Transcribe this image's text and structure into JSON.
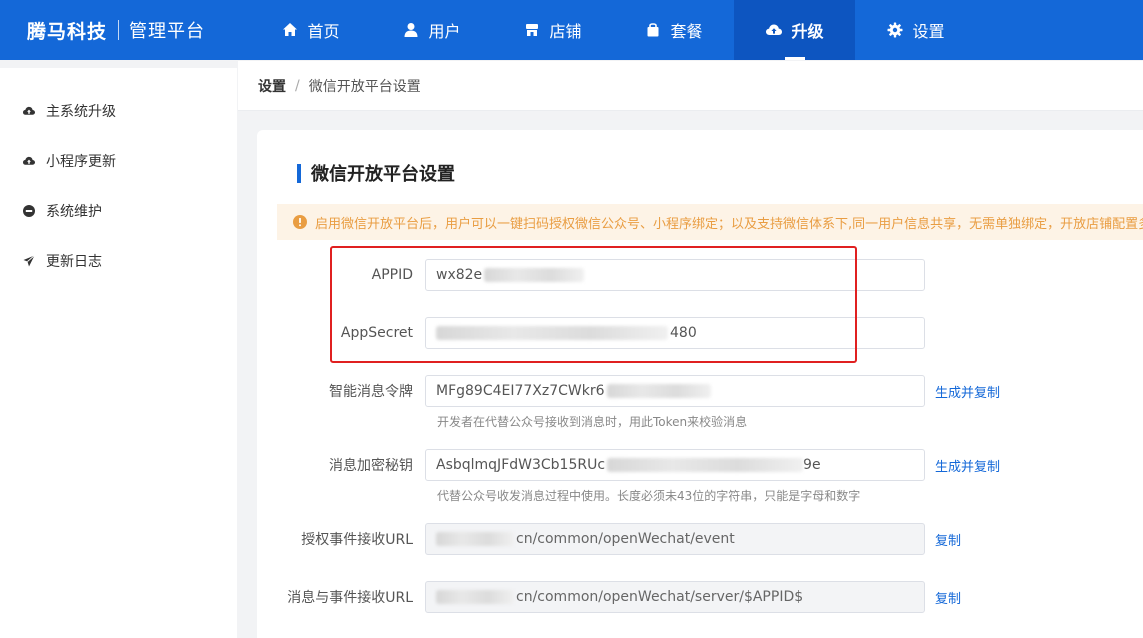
{
  "header": {
    "brand": "腾马科技",
    "subtitle": "管理平台",
    "nav": [
      {
        "label": "首页",
        "icon": "home-icon"
      },
      {
        "label": "用户",
        "icon": "user-icon"
      },
      {
        "label": "店铺",
        "icon": "store-icon"
      },
      {
        "label": "套餐",
        "icon": "package-icon"
      },
      {
        "label": "升级",
        "icon": "cloud-upload-icon",
        "active": true
      },
      {
        "label": "设置",
        "icon": "gear-icon"
      }
    ]
  },
  "sidebar": {
    "items": [
      {
        "label": "主系统升级",
        "icon": "cloud-upload-icon"
      },
      {
        "label": "小程序更新",
        "icon": "cloud-upload-icon"
      },
      {
        "label": "系统维护",
        "icon": "minus-circle-icon"
      },
      {
        "label": "更新日志",
        "icon": "paper-plane-icon"
      }
    ]
  },
  "breadcrumb": {
    "root": "设置",
    "separator": "/",
    "current": "微信开放平台设置"
  },
  "card": {
    "title": "微信开放平台设置",
    "notice": "启用微信开放平台后，用户可以一键扫码授权微信公众号、小程序绑定；以及支持微信体系下,同一用户信息共享，无需单独绑定，开放店铺配置多"
  },
  "form": {
    "appid": {
      "label": "APPID",
      "value": "wx82e"
    },
    "appsecret": {
      "label": "AppSecret",
      "value": "480"
    },
    "token": {
      "label": "智能消息令牌",
      "value": "MFg89C4EI77Xz7CWkr6",
      "action": "生成并复制",
      "hint": "开发者在代替公众号接收到消息时，用此Token来校验消息"
    },
    "aeskey": {
      "label": "消息加密秘钥",
      "value": "AsbqlmqJFdW3Cb15RUc",
      "value_tail": "9e",
      "action": "生成并复制",
      "hint": "代替公众号收发消息过程中使用。长度必须未43位的字符串，只能是字母和数字"
    },
    "auth_url": {
      "label": "授权事件接收URL",
      "value": "cn/common/openWechat/event",
      "action": "复制"
    },
    "msg_url": {
      "label": "消息与事件接收URL",
      "value": "cn/common/openWechat/server/$APPID$",
      "action": "复制"
    }
  },
  "colors": {
    "primary": "#1468d8",
    "active_nav": "#0d55c0",
    "notice_bg": "#fdf3e6",
    "notice_text": "#e99d42",
    "highlight": "#e02020"
  }
}
